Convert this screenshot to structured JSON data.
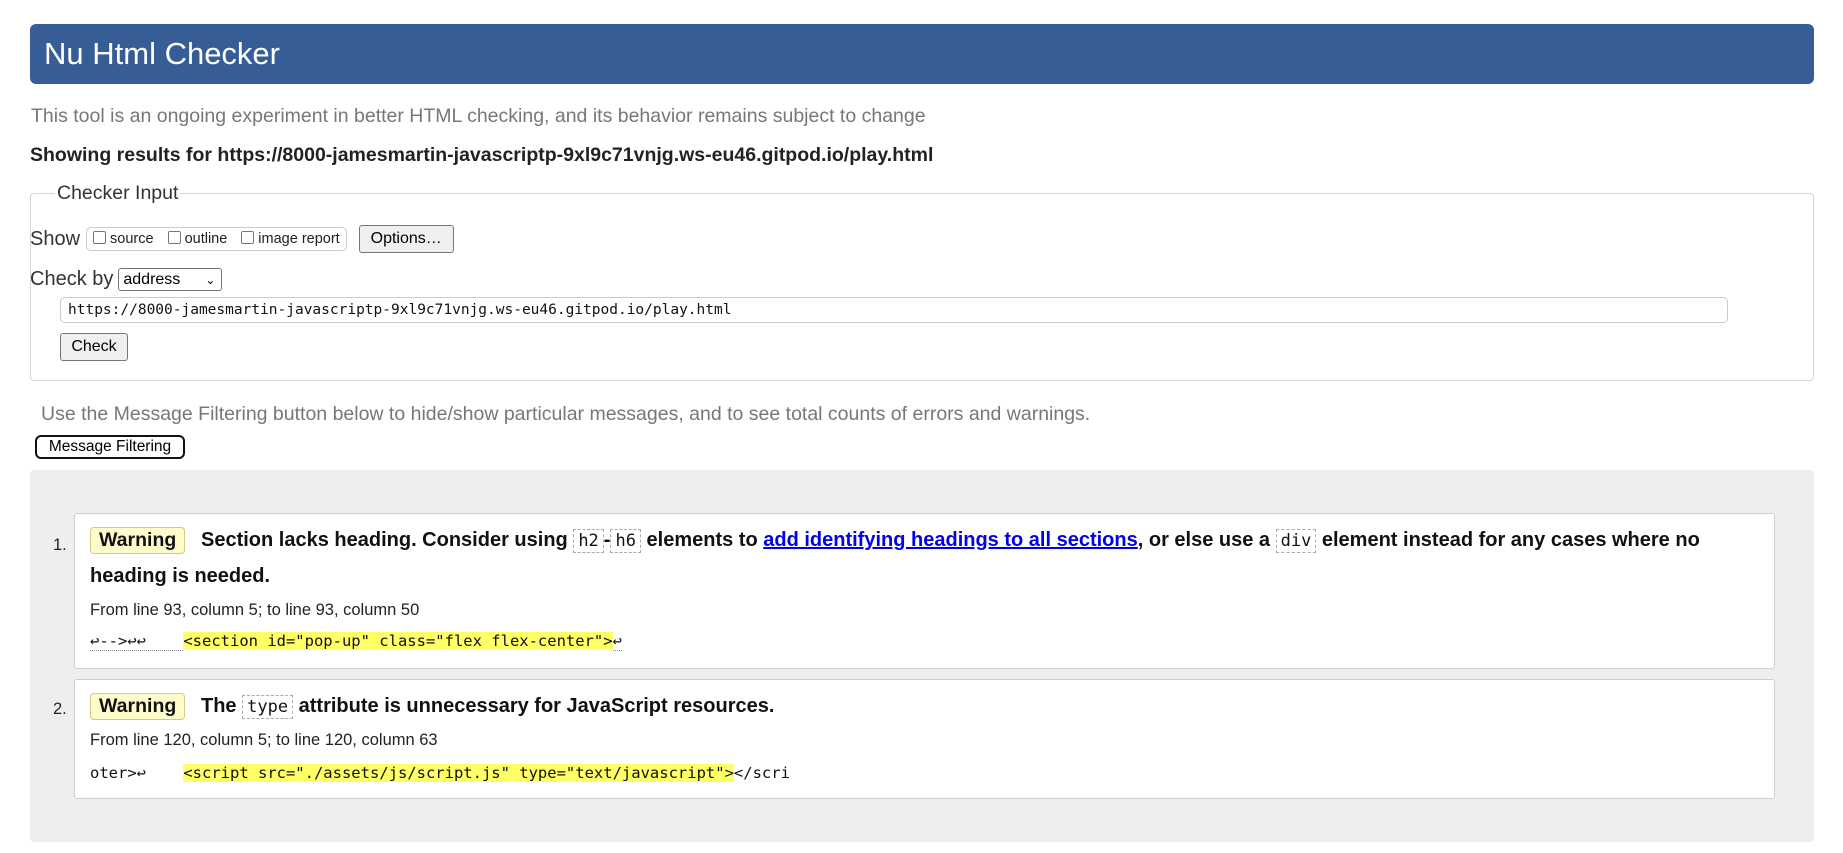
{
  "header": {
    "title": "Nu Html Checker"
  },
  "intro": "This tool is an ongoing experiment in better HTML checking, and its behavior remains subject to change",
  "showing": "Showing results for https://8000-jamesmartin-javascriptp-9xl9c71vnjg.ws-eu46.gitpod.io/play.html",
  "checker_input": {
    "legend": "Checker Input",
    "show_label": "Show",
    "options": [
      {
        "label": "source",
        "checked": false
      },
      {
        "label": "outline",
        "checked": false
      },
      {
        "label": "image report",
        "checked": false
      }
    ],
    "options_button": "Options…",
    "check_by_label": "Check by",
    "check_by_value": "address",
    "url_value": "https://8000-jamesmartin-javascriptp-9xl9c71vnjg.ws-eu46.gitpod.io/play.html",
    "check_button": "Check"
  },
  "filtering": {
    "text": "Use the Message Filtering button below to hide/show particular messages, and to see total counts of errors and warnings.",
    "button": "Message Filtering"
  },
  "messages": [
    {
      "number": "1.",
      "type": "Warning",
      "text_a": "Section lacks heading. Consider using",
      "code_a": "h2",
      "sep": "-",
      "code_b": "h6",
      "text_b": "elements to",
      "link": "add identifying headings to all sections",
      "text_c": ", or else use a",
      "code_c": "div",
      "text_d": "element instead for any cases where no",
      "text_e": "heading is needed.",
      "location": "From line 93, column 5; to line 93, column 50",
      "extract_pre": "↩-->↩↩    ",
      "extract_hl": "<section id=\"pop-up\" class=\"flex flex-center\">",
      "extract_post": "↩"
    },
    {
      "number": "2.",
      "type": "Warning",
      "text_a": "The",
      "code_a": "type",
      "text_b": "attribute is unnecessary for JavaScript resources.",
      "location": "From line 120, column 5; to line 120, column 63",
      "extract_pre": "oter>↩    ",
      "extract_hl": "<script src=\"./assets/js/script.js\" type=\"text/javascript\">",
      "extract_post": "</scri"
    }
  ]
}
